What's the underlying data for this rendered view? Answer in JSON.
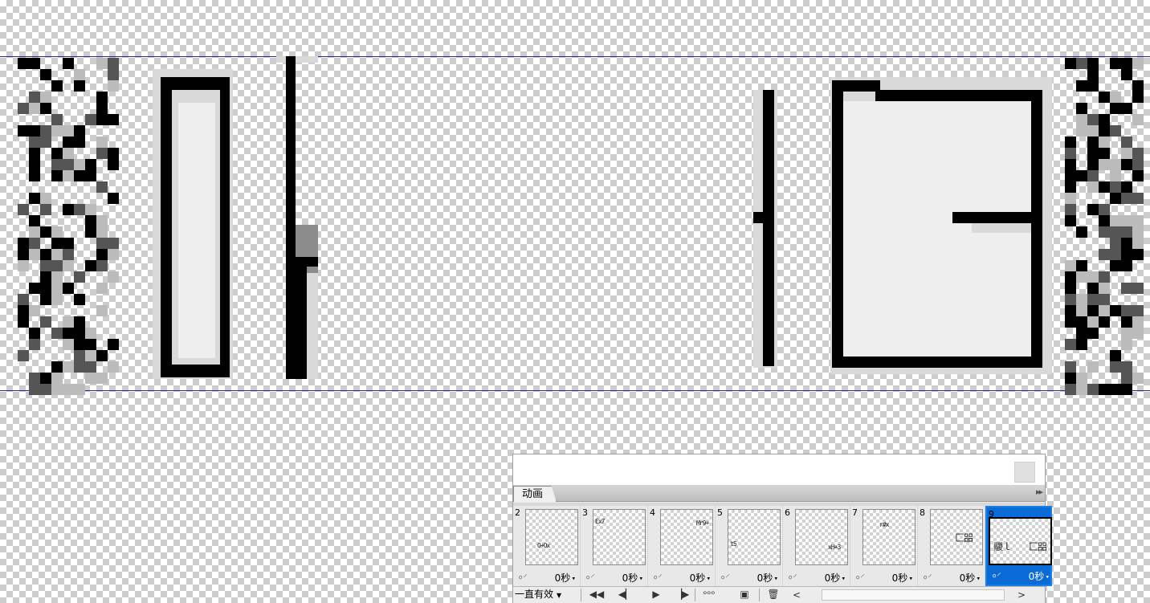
{
  "colors": {
    "guide_line": "#2b2b8e",
    "selection": "#0a6ad6",
    "panel_bg": "#ececec"
  },
  "panel": {
    "tab_label": "动画",
    "menu_icon": "double-chevron-right-icon",
    "frames": [
      {
        "number": "2",
        "duration": "0秒",
        "thumb_text": "O+Ox"
      },
      {
        "number": "3",
        "duration": "0秒",
        "thumb_text": "Ex7"
      },
      {
        "number": "4",
        "duration": "0秒",
        "thumb_text": "Mr9+"
      },
      {
        "number": "5",
        "duration": "0秒",
        "thumb_text": "t5"
      },
      {
        "number": "6",
        "duration": "0秒",
        "thumb_text": "xH+3"
      },
      {
        "number": "7",
        "duration": "0秒",
        "thumb_text": "r#x"
      },
      {
        "number": "8",
        "duration": "0秒",
        "thumb_text": "匚㗊"
      },
      {
        "number": "9",
        "duration": "0秒",
        "thumb_text": "鬷ｌ　　匚㗊",
        "selected": true
      }
    ],
    "loop_label": "一直有效",
    "controls": [
      {
        "name": "first-frame-icon",
        "glyph": "◀◀"
      },
      {
        "name": "previous-frame-icon",
        "glyph": "◀▏"
      },
      {
        "name": "play-icon",
        "glyph": "▶"
      },
      {
        "name": "next-frame-icon",
        "glyph": "▕▶"
      },
      {
        "name": "tween-icon",
        "glyph": "ᵒᵒᵒ"
      },
      {
        "name": "duplicate-frame-icon",
        "glyph": "▣"
      },
      {
        "name": "delete-frame-icon",
        "glyph": "🗑"
      }
    ],
    "scroll_left": "<",
    "scroll_right": ">"
  }
}
